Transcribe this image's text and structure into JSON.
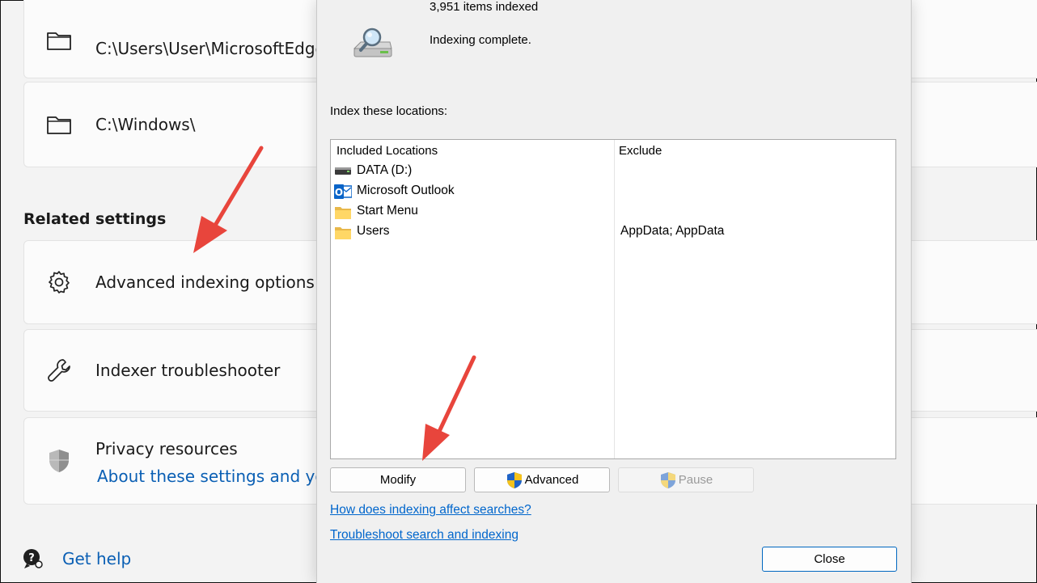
{
  "settings": {
    "locations": [
      {
        "path": "C:\\Users\\User\\MicrosoftEdgeB",
        "icon": "folder-icon"
      },
      {
        "path": "C:\\Windows\\",
        "icon": "folder-icon"
      }
    ],
    "related_settings_title": "Related settings",
    "advanced_indexing": "Advanced indexing options",
    "indexer_troubleshooter": "Indexer troubleshooter",
    "privacy_resources": "Privacy resources",
    "privacy_link": "About these settings and you",
    "get_help": "Get help"
  },
  "dialog": {
    "items_indexed": "3,951 items indexed",
    "status": "Indexing complete.",
    "index_locations_label": "Index these locations:",
    "columns": {
      "included": "Included Locations",
      "exclude": "Exclude"
    },
    "rows": [
      {
        "name": "DATA (D:)",
        "exclude": "",
        "icon": "drive-icon"
      },
      {
        "name": "Microsoft Outlook",
        "exclude": "",
        "icon": "outlook-icon"
      },
      {
        "name": "Start Menu",
        "exclude": "",
        "icon": "folder-icon"
      },
      {
        "name": "Users",
        "exclude": "AppData; AppData",
        "icon": "folder-icon"
      }
    ],
    "buttons": {
      "modify": "Modify",
      "advanced": "Advanced",
      "pause": "Pause",
      "close": "Close"
    },
    "links": {
      "how_indexing": "How does indexing affect searches?",
      "troubleshoot": "Troubleshoot search and indexing"
    }
  },
  "colors": {
    "accent_link": "#0a5fb4",
    "arrow": "#e8453c",
    "dialog_bg": "#f0f0f0"
  }
}
